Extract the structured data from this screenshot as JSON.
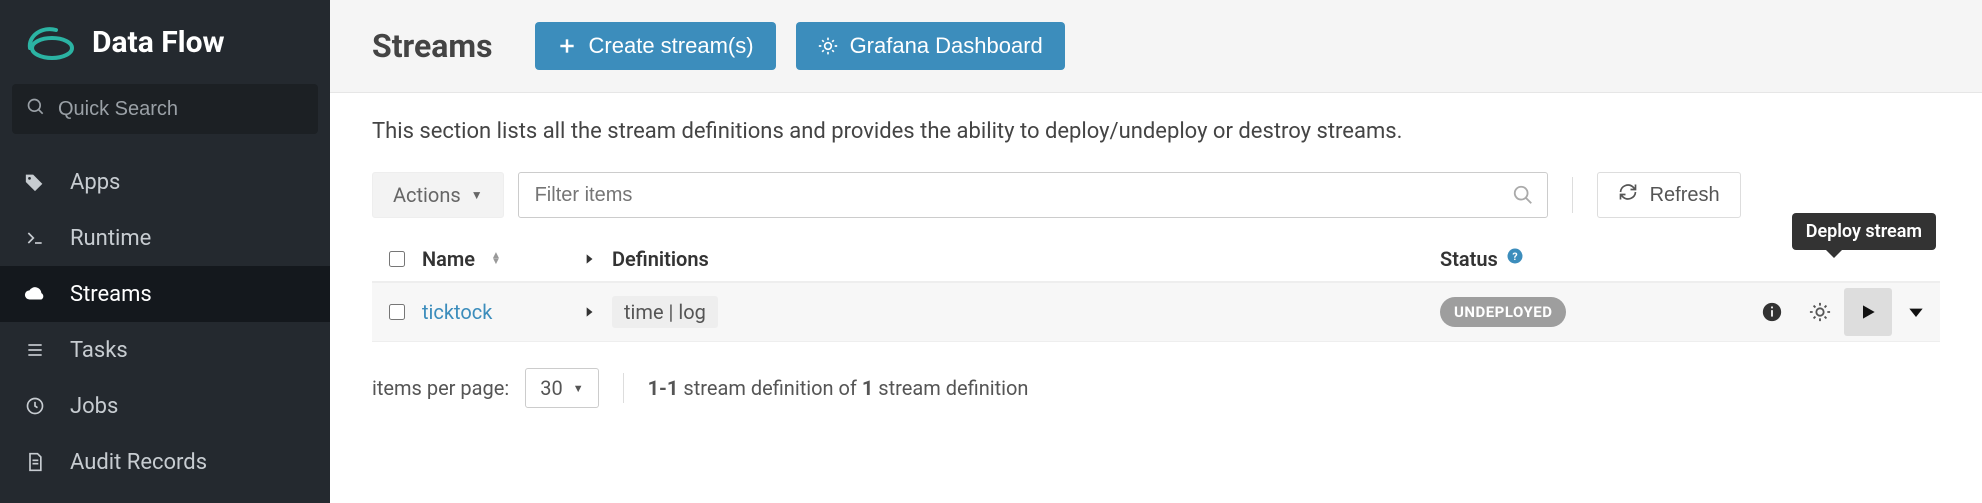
{
  "brand": {
    "title": "Data Flow"
  },
  "search": {
    "placeholder": "Quick Search"
  },
  "nav": {
    "items": [
      {
        "label": "Apps"
      },
      {
        "label": "Runtime"
      },
      {
        "label": "Streams"
      },
      {
        "label": "Tasks"
      },
      {
        "label": "Jobs"
      },
      {
        "label": "Audit Records"
      }
    ],
    "activeIndex": 2
  },
  "header": {
    "title": "Streams",
    "create_btn": "Create stream(s)",
    "grafana_btn": "Grafana Dashboard"
  },
  "lead": "This section lists all the stream definitions and provides the ability to deploy/undeploy or destroy streams.",
  "controls": {
    "actions_label": "Actions",
    "filter_placeholder": "Filter items",
    "refresh_label": "Refresh"
  },
  "table": {
    "columns": {
      "name": "Name",
      "definitions": "Definitions",
      "status": "Status"
    },
    "rows": [
      {
        "name": "ticktock",
        "definition": "time | log",
        "status": "UNDEPLOYED"
      }
    ]
  },
  "tooltip": {
    "deploy": "Deploy stream"
  },
  "pagination": {
    "items_per_page_label": "items per page:",
    "page_size": "30",
    "range": "1-1",
    "mid_a": " stream definition of ",
    "total": "1",
    "mid_b": " stream definition"
  }
}
